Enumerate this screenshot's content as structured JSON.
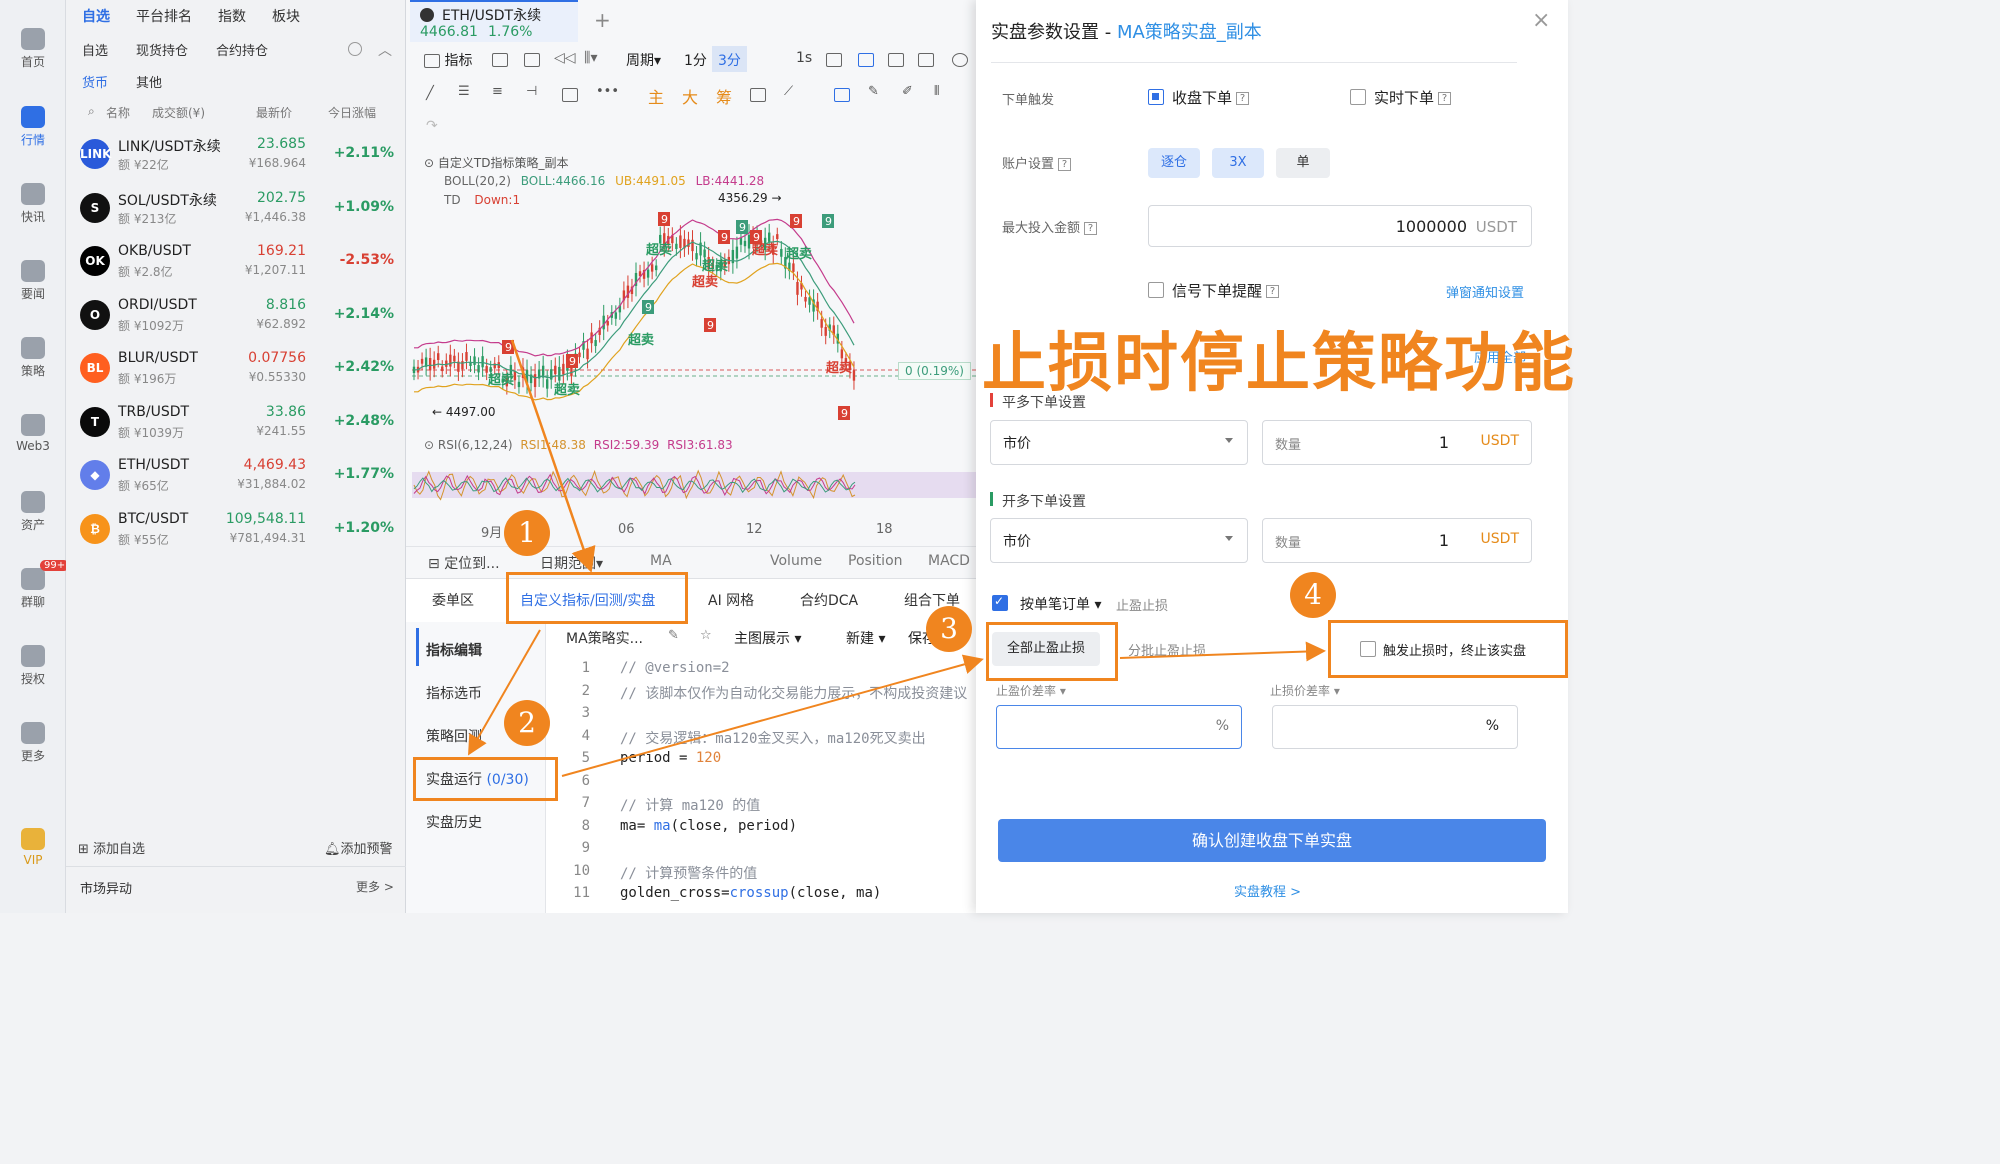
{
  "rail": {
    "items": [
      {
        "label": "首页"
      },
      {
        "label": "行情"
      },
      {
        "label": "快讯"
      },
      {
        "label": "要闻"
      },
      {
        "label": "策略"
      },
      {
        "label": "Web3"
      },
      {
        "label": "资产"
      },
      {
        "label": "群聊"
      },
      {
        "label": "授权"
      },
      {
        "label": "更多"
      },
      {
        "label": "VIP"
      }
    ],
    "badge": "99+",
    "accent": "#2f6fe4"
  },
  "watch": {
    "tabs": [
      "自选",
      "平台排名",
      "指数",
      "板块"
    ],
    "subtabs": [
      "自选",
      "现货持仓",
      "合约持仓"
    ],
    "subtabs2": [
      "货币",
      "其他"
    ],
    "head": {
      "name": "名称",
      "vol": "成交额(¥)",
      "price": "最新价",
      "chg": "今日涨幅"
    },
    "rows": [
      {
        "name": "LINK/USDT永续",
        "vol": "额 ¥22亿",
        "price": "23.685",
        "cny": "¥168.964",
        "chg": "+2.11%",
        "icon": "LINK",
        "color": "#2a5ada",
        "dir": "up"
      },
      {
        "name": "SOL/USDT永续",
        "vol": "额 ¥213亿",
        "price": "202.75",
        "cny": "¥1,446.38",
        "chg": "+1.09%",
        "icon": "S",
        "color": "#111",
        "dir": "up"
      },
      {
        "name": "OKB/USDT",
        "vol": "额 ¥2.8亿",
        "price": "169.21",
        "cny": "¥1,207.11",
        "chg": "-2.53%",
        "icon": "OK",
        "color": "#000",
        "dir": "down"
      },
      {
        "name": "ORDI/USDT",
        "vol": "额 ¥1092万",
        "price": "8.816",
        "cny": "¥62.892",
        "chg": "+2.14%",
        "icon": "O",
        "color": "#111",
        "dir": "up"
      },
      {
        "name": "BLUR/USDT",
        "vol": "额 ¥196万",
        "price": "0.07756",
        "cny": "¥0.55330",
        "chg": "+2.42%",
        "icon": "BL",
        "color": "#ff5f1f",
        "dir": "up",
        "price_dir": "down"
      },
      {
        "name": "TRB/USDT",
        "vol": "额 ¥1039万",
        "price": "33.86",
        "cny": "¥241.55",
        "chg": "+2.48%",
        "icon": "T",
        "color": "#0a0a0a",
        "dir": "up"
      },
      {
        "name": "ETH/USDT",
        "vol": "额 ¥65亿",
        "price": "4,469.43",
        "cny": "¥31,884.02",
        "chg": "+1.77%",
        "icon": "◆",
        "color": "#627eea",
        "dir": "up",
        "price_dir": "down"
      },
      {
        "name": "BTC/USDT",
        "vol": "额 ¥55亿",
        "price": "109,548.11",
        "cny": "¥781,494.31",
        "chg": "+1.20%",
        "icon": "₿",
        "color": "#f7931a",
        "dir": "up"
      }
    ],
    "add_watch": "添加自选",
    "add_alert": "添加预警",
    "market_move": "市场异动",
    "more": "更多 >"
  },
  "chart": {
    "pair": "ETH/USDT永续",
    "price": "4466.81",
    "change": "1.76%",
    "toolbar": [
      "指标",
      "周期",
      "1分",
      "3分",
      "1s"
    ],
    "draw_tools": [
      "主",
      "大",
      "筹"
    ],
    "strategy": "自定义TD指标策略_副本",
    "boll": "BOLL(20,2)",
    "boll_vals": [
      "BOLL:4466.16",
      "UB:4491.05",
      "LB:4441.28"
    ],
    "td": "TD",
    "td_val": "Down:1",
    "hi_label": "4356.29 →",
    "lo_label": "← 4497.00",
    "price_tag": "0 (0.19%)",
    "rsi": "RSI(6,12,24)",
    "rsi_vals": [
      "RSI1:48.38",
      "RSI2:59.39",
      "RSI3:61.83"
    ],
    "x_ticks": [
      "9月",
      "06",
      "12",
      "18"
    ],
    "markers": [
      "超卖",
      "超卖",
      "超卖",
      "超卖",
      "超卖",
      "超卖",
      "超卖",
      "超卖",
      "超卖"
    ],
    "nums": [
      "9",
      "9",
      "9",
      "9",
      "9",
      "9",
      "9",
      "9",
      "9",
      "9",
      "9"
    ],
    "sub_tabs": [
      "定位到...",
      "日期范围",
      "MA",
      "Volume",
      "Position",
      "MACD"
    ]
  },
  "bottom": {
    "tabs": [
      "委单区",
      "自定义指标/回测/实盘",
      "AI 网格",
      "合约DCA",
      "组合下单"
    ],
    "side": [
      "指标编辑",
      "指标选币",
      "策略回测",
      "实盘运行",
      "(0/30)",
      "实盘历史"
    ],
    "editor_tabs": [
      "MA策略实...",
      "主图展示",
      "新建",
      "保存"
    ],
    "code_lines": [
      "1",
      "2",
      "3",
      "4",
      "5",
      "6",
      "7",
      "8",
      "9",
      "10",
      "11"
    ],
    "code": [
      "// @version=2",
      "// 该脚本仅作为自动化交易能力展示，不构成投资建议",
      "",
      "// 交易逻辑：ma120金叉买入，ma120死叉卖出",
      "period = 120",
      "",
      "// 计算 ma120 的值",
      "ma= ma(close, period)",
      "",
      "// 计算预警条件的值",
      "golden_cross=crossup(close, ma)"
    ]
  },
  "panel": {
    "title": "实盘参数设置 - ",
    "title_link": "MA策略实盘_副本",
    "trigger_label": "下单触发",
    "trigger_opt1": "收盘下单",
    "trigger_opt2": "实时下单",
    "account_label": "账户设置",
    "account_opts": [
      "逐仓",
      "3X",
      "单"
    ],
    "max_label": "最大投入金额",
    "max_value": "1000000",
    "max_unit": "USDT",
    "signal_label": "信号下单提醒",
    "notify_link": "弹窗通知设置",
    "apply_link": "应用全部",
    "close_long": "平多下单设置",
    "open_long": "开多下单设置",
    "order_type": "市价",
    "qty_label": "数量",
    "qty_value": "1",
    "qty_unit": "USDT",
    "split_label": "按单笔订单",
    "tpsl_label": "止盈止损",
    "all_tpsl": "全部止盈止损",
    "split_tpsl": "分批止盈止损",
    "stop_opt": "触发止损时，终止该实盘",
    "tp_label": "止盈价差率",
    "sl_label": "止损价差率",
    "pct": "%",
    "confirm": "确认创建收盘下单实盘",
    "tutorial": "实盘教程 >",
    "close": "×"
  },
  "annotation": {
    "caption": "止损时停止策略功能",
    "steps": [
      "1",
      "2",
      "3",
      "4"
    ],
    "color": "#f0851f"
  }
}
